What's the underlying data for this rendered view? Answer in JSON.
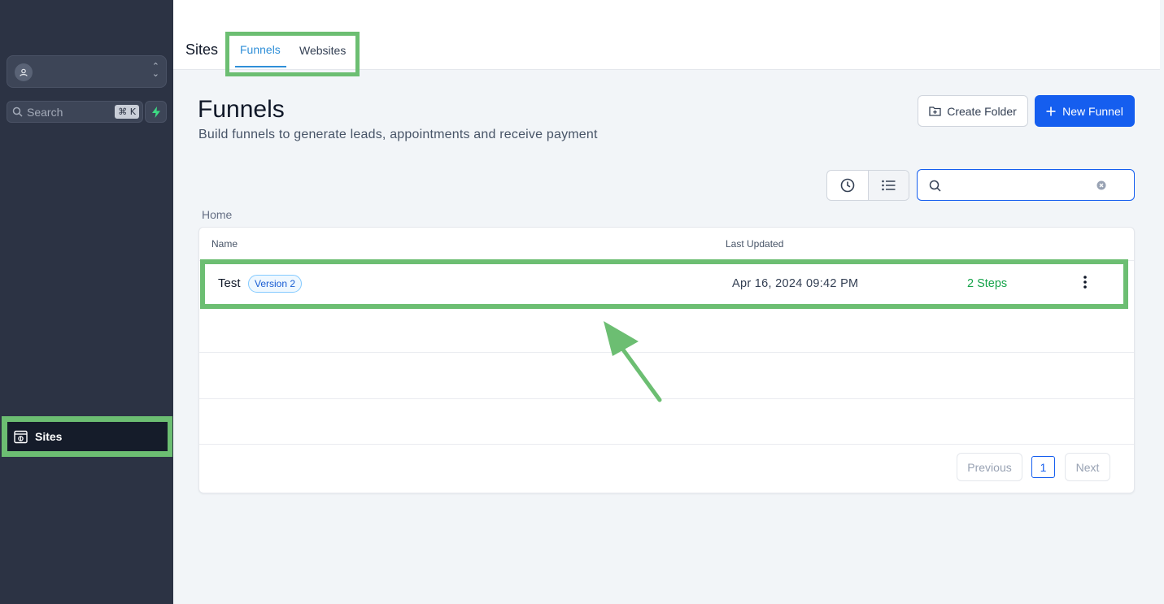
{
  "sidebar": {
    "search_placeholder": "Search",
    "search_shortcut": "⌘ K",
    "nav_sites_label": "Sites"
  },
  "topbar": {
    "section_title": "Sites",
    "tabs": [
      {
        "label": "Funnels",
        "active": true
      },
      {
        "label": "Websites",
        "active": false
      }
    ]
  },
  "page": {
    "title": "Funnels",
    "subtitle": "Build funnels to generate leads, appointments and receive payment",
    "create_folder_label": "Create Folder",
    "new_funnel_label": "New Funnel",
    "search_value": "",
    "breadcrumb": "Home"
  },
  "table": {
    "columns": [
      "Name",
      "Last Updated"
    ],
    "rows": [
      {
        "name": "Test",
        "badge": "Version 2",
        "last_updated": "Apr 16, 2024 09:42 PM",
        "steps": "2 Steps"
      }
    ]
  },
  "pagination": {
    "previous_label": "Previous",
    "current_page": "1",
    "next_label": "Next"
  },
  "colors": {
    "accent": "#155eef",
    "highlight": "#6cbe72",
    "sidebar_bg": "#2c3344",
    "steps_green": "#16a34a"
  }
}
